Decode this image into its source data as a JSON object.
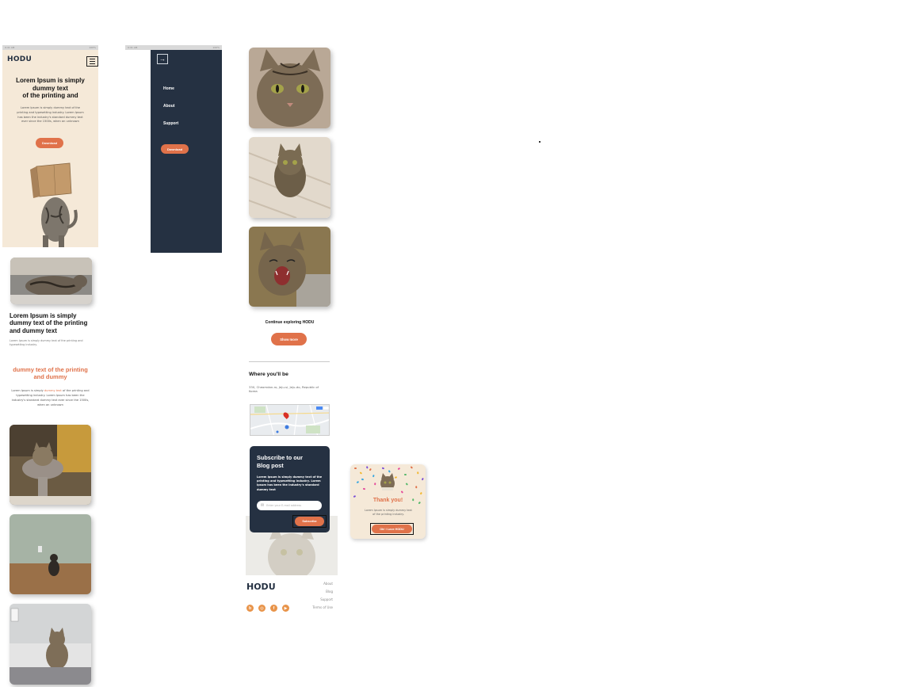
{
  "brand": {
    "logo": "HODU",
    "accent": "#e0724a",
    "dark": "#253142",
    "cream": "#f5e9d8"
  },
  "status_bar": {
    "left": "9:41 AM",
    "right": "100%"
  },
  "hero": {
    "title_line1": "Lorem Ipsum is simply",
    "title_line2": "dummy text",
    "title_line3": "of the printing and",
    "body": "Lorem Ipsum is simply dummy text of the printing and typesetting industry. Lorem Ipsum has been the industry's standard dummy text ever since the 1500s, when an unknown",
    "button": "Download",
    "menu_icon": "hamburger-icon"
  },
  "menu": {
    "close_icon": "arrow-right-icon",
    "items": [
      {
        "label": "Home"
      },
      {
        "label": "About"
      },
      {
        "label": "Support"
      }
    ],
    "button": "Download"
  },
  "section1": {
    "title": "Lorem Ipsum is simply dummy text of the printing and dummy text",
    "body": "Lorem Ipsum is simply dummy text of the printing and typesetting industry."
  },
  "section2": {
    "title": "dummy text of the printing and dummy",
    "body_prefix": "Lorem Ipsum is simply",
    "body_highlight": "dummy text",
    "body_suffix": "of the printing and typesetting industry. Lorem Ipsum has been the industry's standard dummy text ever since the 1500s, when an unknown"
  },
  "explore": {
    "title": "Continue exploring HODU",
    "button": "Show more"
  },
  "location": {
    "title": "Where you'll be",
    "address": "330, Cheomdan-ro, Jeju-si, Jeju-do, Republic of Korea"
  },
  "subscribe": {
    "title_line1": "Subscribe to our",
    "title_line2": "Blog post",
    "body": "Lorem Ipsum is simply dummy text of the printing and typesetting industry. Lorem Ipsum has been the industry's standard dummy text",
    "input_placeholder": "Enter your E-mail address",
    "button": "Subscribe"
  },
  "footer": {
    "logo": "HODU",
    "links": [
      {
        "label": "About"
      },
      {
        "label": "Blog"
      },
      {
        "label": "Support"
      },
      {
        "label": "Terms of Use"
      }
    ],
    "socials": [
      {
        "name": "blog-icon",
        "glyph": "b"
      },
      {
        "name": "instagram-icon",
        "glyph": "◎"
      },
      {
        "name": "facebook-icon",
        "glyph": "f"
      },
      {
        "name": "youtube-icon",
        "glyph": "▶"
      }
    ]
  },
  "modal": {
    "title": "Thank you!",
    "body": "Lorem Ipsum is simply dummy text of the printing industry.",
    "button": "Ok! I Love HODU"
  }
}
